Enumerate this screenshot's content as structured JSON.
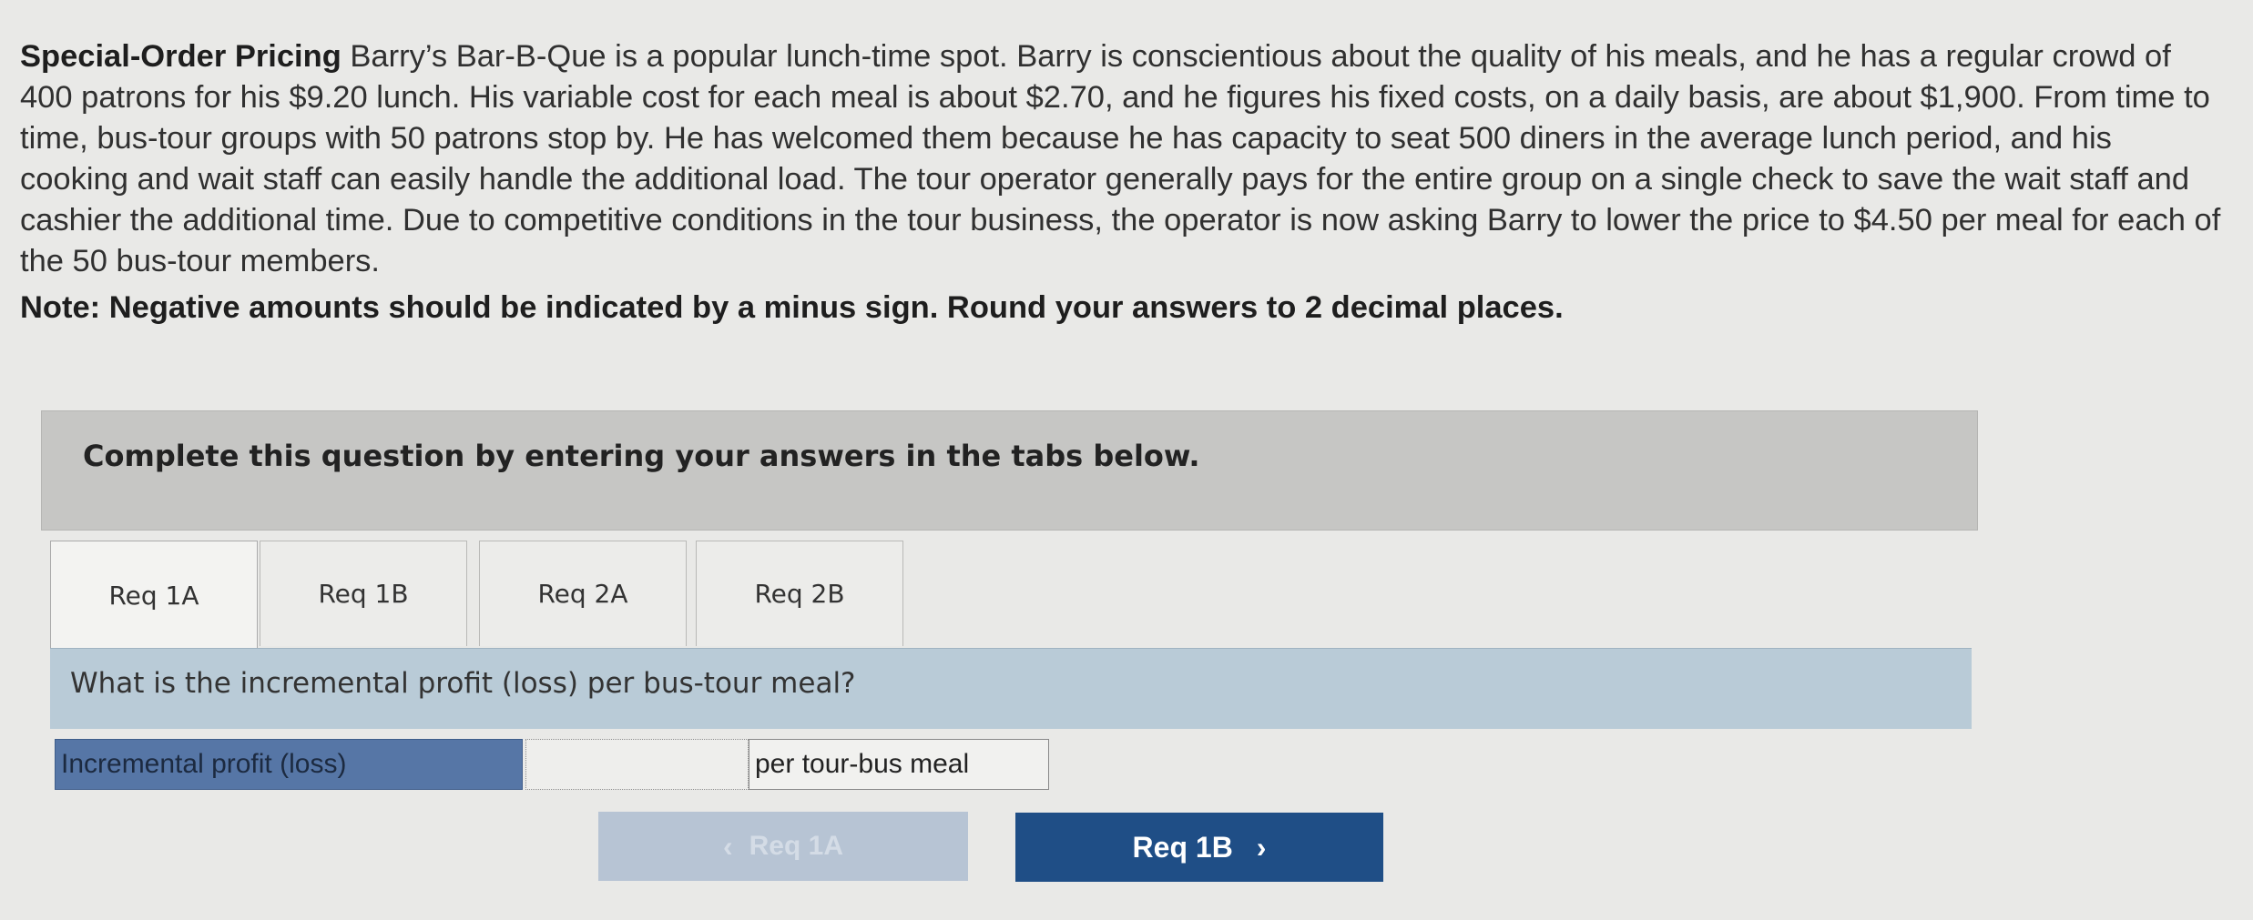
{
  "problem": {
    "title": "Special-Order Pricing",
    "body": "Barry’s Bar-B-Que is a popular lunch-time spot. Barry is conscientious about the quality of his meals, and he has a regular crowd of 400 patrons for his $9.20 lunch. His variable cost for each meal is about $2.70, and he figures his fixed costs, on a daily basis, are about $1,900. From time to time, bus-tour groups with 50 patrons stop by. He has welcomed them because he has capacity to seat 500 diners in the average lunch period, and his cooking and wait staff can easily handle the additional load. The tour operator generally pays for the entire group on a single check to save the wait staff and cashier the additional time. Due to competitive conditions in the tour business, the operator is now asking Barry to lower the price to $4.50 per meal for each of the 50 bus-tour members.",
    "note": "Note: Negative amounts should be indicated by a minus sign. Round your answers to 2 decimal places."
  },
  "instruction": "Complete this question by entering your answers in the tabs below.",
  "tabs": [
    {
      "label": "Req 1A",
      "active": true
    },
    {
      "label": "Req 1B",
      "active": false
    },
    {
      "label": "Req 2A",
      "active": false
    },
    {
      "label": "Req 2B",
      "active": false
    }
  ],
  "question": "What is the incremental profit (loss) per bus-tour meal?",
  "answer": {
    "label": "Incremental profit (loss)",
    "value": "",
    "unit": "per tour-bus meal"
  },
  "nav": {
    "prev_label": "Req 1A",
    "next_label": "Req 1B",
    "prev_icon": "chevron-left-icon",
    "next_icon": "chevron-right-icon"
  },
  "colors": {
    "next_button": "#1f4e86",
    "prev_button_disabled": "#b7c4d4",
    "answer_label_bg": "#5676a6",
    "question_bar": "#b9cbd7"
  }
}
